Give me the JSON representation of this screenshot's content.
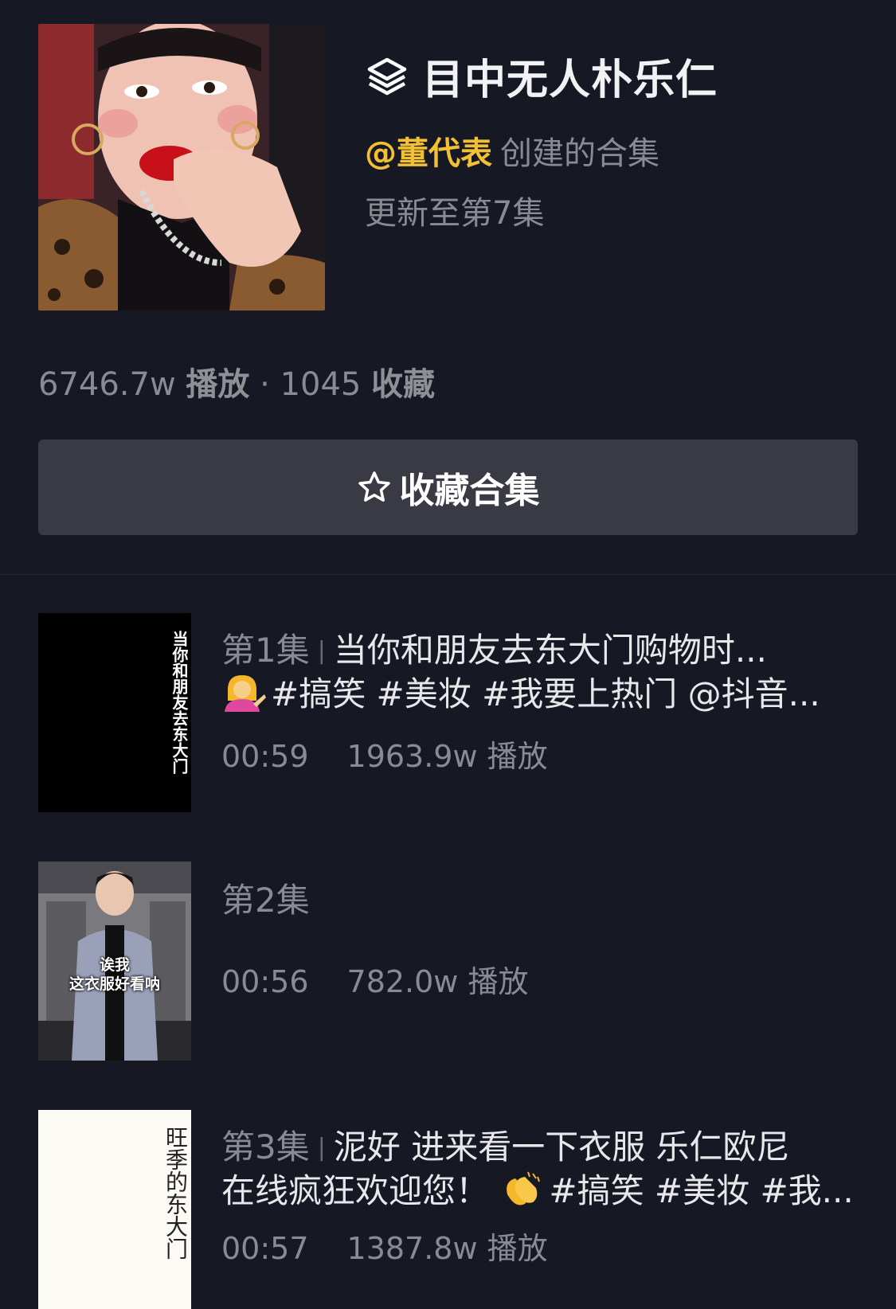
{
  "collection": {
    "title": "目中无人朴乐仁",
    "creator_handle": "@董代表",
    "creator_suffix": "创建的合集",
    "updated": "更新至第7集",
    "plays_value": "6746.7w",
    "plays_label": "播放",
    "dot": "·",
    "favorites_value": "1045",
    "favorites_label": "收藏",
    "collect_button": "收藏合集"
  },
  "episodes": [
    {
      "number": "第1集",
      "title_line1": "当你和朋友去东大门购物时...",
      "title_line2": "#搞笑 #美妆 #我要上热门 @抖音...",
      "emoji": "person-tipping-hand-emoji",
      "duration": "00:59",
      "plays": "1963.9w 播放",
      "thumb_text": "当你和朋友去东大门"
    },
    {
      "number": "第2集",
      "duration": "00:56",
      "plays": "782.0w 播放",
      "thumb_caption_1": "诶我",
      "thumb_caption_2": "这衣服好看呐"
    },
    {
      "number": "第3集",
      "title_line1": "泥好 进来看一下衣服 乐仁欧尼",
      "title_line2_pre": "在线疯狂欢迎您！",
      "title_line2_post": "#搞笑 #美妆 #我...",
      "emoji": "clapping-hands-emoji",
      "duration": "00:57",
      "plays": "1387.8w 播放",
      "thumb_text": "旺季的东大门"
    }
  ],
  "icons": {
    "layers": "layers-icon",
    "star": "star-outline-icon"
  },
  "colors": {
    "background": "#161823",
    "accent": "#f3c034",
    "button_bg": "#393a44",
    "muted_text": "#8a8b92"
  }
}
